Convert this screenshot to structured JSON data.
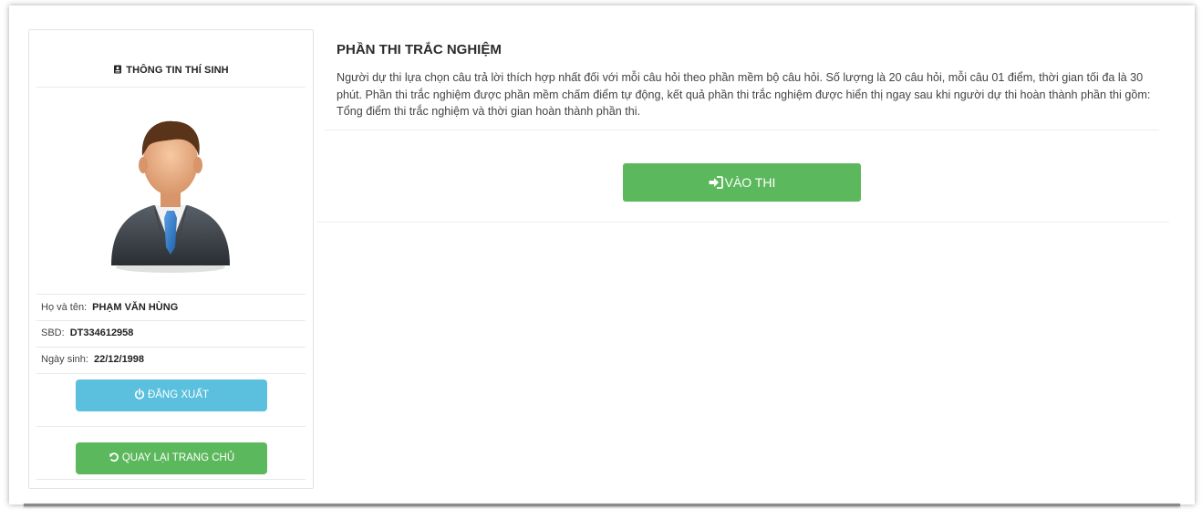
{
  "sidebar": {
    "title": "THÔNG TIN THÍ SINH",
    "title_icon": "id-card-icon",
    "avatar_icon": "user-avatar-businessman",
    "fields": [
      {
        "label": "Họ và tên:",
        "value": "PHẠM VĂN HÙNG"
      },
      {
        "label": "SBD:",
        "value": "DT334612958"
      },
      {
        "label": "Ngày sinh:",
        "value": "22/12/1998"
      }
    ],
    "logout_label": "ĐĂNG XUẤT",
    "logout_icon": "power-icon",
    "home_label": "QUAY LẠI TRANG CHỦ",
    "home_icon": "refresh-back-icon"
  },
  "main": {
    "title": "PHẦN THI TRẮC NGHIỆM",
    "description": "Người dự thi lựa chọn câu trả lời thích hợp nhất đối với mỗi câu hỏi theo phần mềm bộ câu hỏi. Số lượng là 20 câu hỏi, mỗi câu 01 điểm, thời gian tối đa là 30 phút. Phần thi trắc nghiệm được phần mềm chấm điểm tự động, kết quả phần thi trắc nghiệm được hiển thị ngay sau khi người dự thi hoàn thành phần thi gồm: Tổng điểm thi trắc nghiệm và thời gian hoàn thành phần thi.",
    "start_label": "VÀO THI",
    "start_icon": "sign-in-icon"
  },
  "colors": {
    "green": "#5cb85c",
    "info_blue": "#5bc0de"
  }
}
